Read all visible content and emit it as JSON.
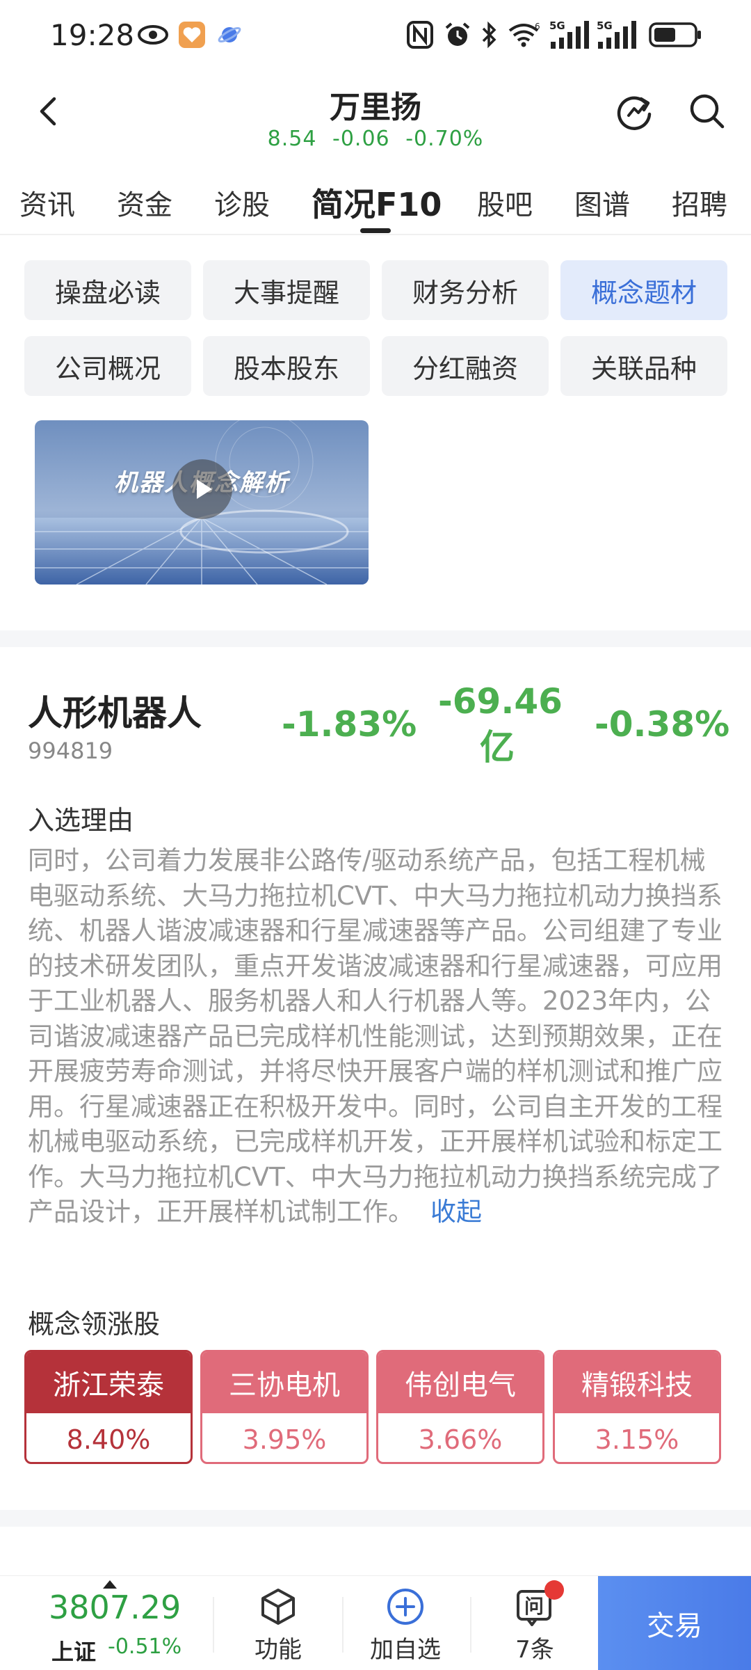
{
  "status_bar": {
    "time": "19:28",
    "icons": [
      "eye-icon",
      "app-heart-icon",
      "planet-icon",
      "nfc-icon",
      "alarm-icon",
      "bluetooth-icon",
      "wifi-icon",
      "signal-5g-icon",
      "signal-5g-icon",
      "battery-icon"
    ],
    "network_label_1": "5G",
    "network_label_2": "5G"
  },
  "header": {
    "stock_name": "万里扬",
    "price": "8.54",
    "change": "-0.06",
    "change_pct": "-0.70%"
  },
  "tabs": [
    {
      "label": "资讯",
      "active": false
    },
    {
      "label": "资金",
      "active": false
    },
    {
      "label": "诊股",
      "active": false
    },
    {
      "label": "简况F10",
      "active": true
    },
    {
      "label": "股吧",
      "active": false
    },
    {
      "label": "图谱",
      "active": false
    },
    {
      "label": "招聘",
      "active": false
    }
  ],
  "sub_tabs": [
    {
      "label": "操盘必读",
      "active": false
    },
    {
      "label": "大事提醒",
      "active": false
    },
    {
      "label": "财务分析",
      "active": false
    },
    {
      "label": "概念题材",
      "active": true
    },
    {
      "label": "公司概况",
      "active": false
    },
    {
      "label": "股本股东",
      "active": false
    },
    {
      "label": "分红融资",
      "active": false
    },
    {
      "label": "关联品种",
      "active": false
    }
  ],
  "video": {
    "title": "机器人概念解析"
  },
  "concept": {
    "name": "人形机器人",
    "code": "994819",
    "change_pct": "-1.83%",
    "net_flow": "-69.46亿",
    "stock_change_pct": "-0.38%",
    "reason_title": "入选理由",
    "reason_text": "同时，公司着力发展非公路传/驱动系统产品，包括工程机械电驱动系统、大马力拖拉机CVT、中大马力拖拉机动力换挡系统、机器人谐波减速器和行星减速器等产品。公司组建了专业的技术研发团队，重点开发谐波减速器和行星减速器，可应用于工业机器人、服务机器人和人行机器人等。2023年内，公司谐波减速器产品已完成样机性能测试，达到预期效果，正在开展疲劳寿命测试，并将尽快开展客户端的样机测试和推广应用。行星减速器正在积极开发中。同时，公司自主开发的工程机械电驱动系统，已完成样机开发，正开展样机试验和标定工作。大马力拖拉机CVT、中大马力拖拉机动力换挡系统完成了产品设计，正开展样机试制工作。",
    "collapse_label": "收起",
    "leaders_title": "概念领涨股",
    "leaders": [
      {
        "name": "浙江荣泰",
        "change": "8.40%"
      },
      {
        "name": "三协电机",
        "change": "3.95%"
      },
      {
        "name": "伟创电气",
        "change": "3.66%"
      },
      {
        "name": "精锻科技",
        "change": "3.15%"
      }
    ]
  },
  "bottom_bar": {
    "index_value": "3807.29",
    "index_name": "上证",
    "index_change": "-0.51%",
    "function_label": "功能",
    "add_watch_label": "加自选",
    "ask_label": "7条",
    "ask_icon_text": "问",
    "trade_label": "交易"
  },
  "colors": {
    "down_green": "#2ea043",
    "concept_green": "#4caf50",
    "active_blue": "#3a6fd8",
    "leader_red": "#e06b7a",
    "leader_top_red": "#b5323a",
    "trade_blue": "#4a7be8"
  }
}
